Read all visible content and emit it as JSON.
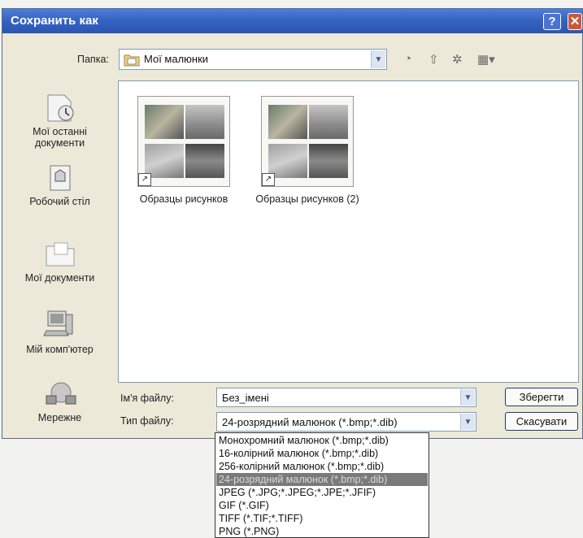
{
  "window": {
    "title": "Сохранить как",
    "help_btn": "?",
    "close_btn": "✕"
  },
  "location": {
    "label": "Папка:",
    "value": "Мої малюнки"
  },
  "toolbar": {
    "back_glyph": "◔",
    "up_glyph": "⇧",
    "new_folder_glyph": "✲",
    "view_glyph": "▦▾"
  },
  "places": [
    {
      "label": "Мої останні документи",
      "icon": "recent-documents-icon"
    },
    {
      "label": "Робочий стіл",
      "icon": "desktop-icon"
    },
    {
      "label": "Мої документи",
      "icon": "my-documents-icon"
    },
    {
      "label": "Мій комп'ютер",
      "icon": "my-computer-icon"
    },
    {
      "label": "Мережне",
      "icon": "network-icon"
    }
  ],
  "files": [
    {
      "name": "Образцы рисунков"
    },
    {
      "name": "Образцы рисунков (2)"
    }
  ],
  "filename": {
    "label": "Ім'я файлу:",
    "value": "Без_імені"
  },
  "filetype": {
    "label": "Тип файлу:",
    "value": "24-розрядний малюнок (*.bmp;*.dib)"
  },
  "buttons": {
    "save": "Зберегти",
    "cancel": "Скасувати"
  },
  "filetype_options": [
    "Монохромний малюнок (*.bmp;*.dib)",
    "16-колірний малюнок (*.bmp;*.dib)",
    "256-колірний малюнок (*.bmp;*.dib)",
    "24-розрядний малюнок (*.bmp;*.dib)",
    "JPEG (*.JPG;*.JPEG;*.JPE;*.JFIF)",
    "GIF (*.GIF)",
    "TIFF (*.TIF;*.TIFF)",
    "PNG (*.PNG)"
  ],
  "selected_option_index": 3,
  "colors": {
    "titlebar": "#3663c4",
    "dialog_bg": "#ece9d8",
    "selection": "#7a7a7a"
  }
}
